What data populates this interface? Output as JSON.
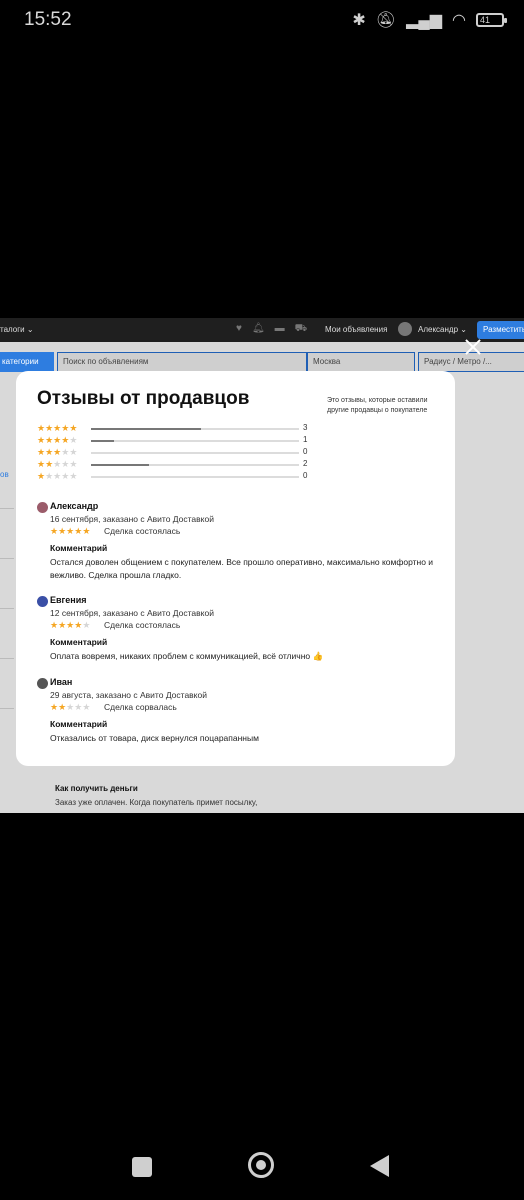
{
  "status_bar": {
    "time": "15:52",
    "battery": "41"
  },
  "site": {
    "catalogs": "талоги ⌄",
    "my_ads": "Мои объявления",
    "user": "Александр ⌄",
    "post_button": "Разместить",
    "category_button": "категории",
    "search_placeholder": "Поиск по объявлениям",
    "city": "Москва",
    "radius": "Радиус / Метро /...",
    "left_link": "ов",
    "how_to_get_money": "Как получить деньги",
    "paid_text": "Заказ уже оплачен. Когда покупатель примет посылку,"
  },
  "modal": {
    "title": "Отзывы от продавцов",
    "note": "Это отзывы, которые оставили другие продавцы о покупателе",
    "ratings": [
      {
        "stars": 5,
        "count": "3",
        "fill": 0.53
      },
      {
        "stars": 4,
        "count": "1",
        "fill": 0.11
      },
      {
        "stars": 3,
        "count": "0",
        "fill": 0
      },
      {
        "stars": 2,
        "count": "2",
        "fill": 0.28
      },
      {
        "stars": 1,
        "count": "0",
        "fill": 0
      }
    ],
    "reviews": [
      {
        "name": "Александр",
        "meta": "16 сентября, заказано с Авито Доставкой",
        "stars": 5,
        "deal": "Сделка состоялась",
        "comment_label": "Комментарий",
        "comment": "Остался доволен общением с покупателем. Все прошло оперативно, максимально комфортно и вежливо. Сделка прошла гладко.",
        "avatar_color": "#9b5c6a"
      },
      {
        "name": "Евгения",
        "meta": "12 сентября, заказано с Авито Доставкой",
        "stars": 4,
        "deal": "Сделка состоялась",
        "comment_label": "Комментарий",
        "comment": "Оплата вовремя, никаких проблем с коммуникацией, всё отлично 👍",
        "avatar_color": "#3a4fa6"
      },
      {
        "name": "Иван",
        "meta": "29 августа, заказано с Авито Доставкой",
        "stars": 2,
        "deal": "Сделка сорвалась",
        "comment_label": "Комментарий",
        "comment": "Отказались от товара, диск вернулся поцарапанным",
        "avatar_color": "#555555"
      }
    ]
  }
}
